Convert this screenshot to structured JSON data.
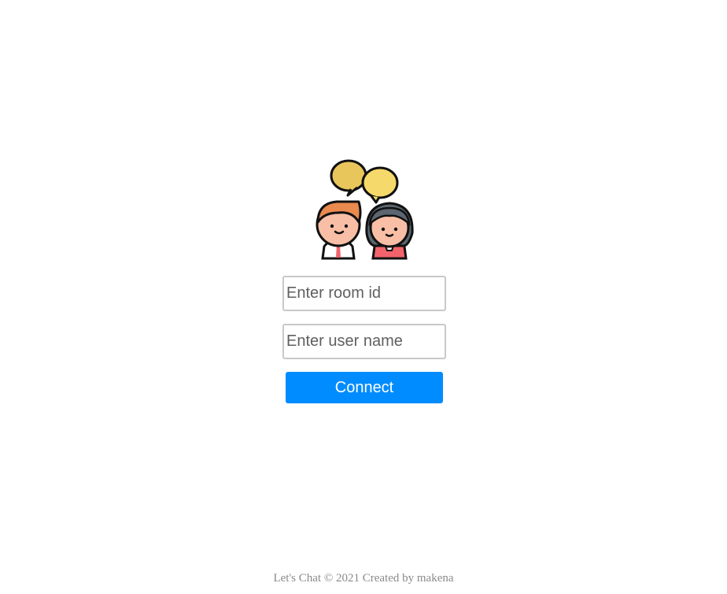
{
  "logo": {
    "icon": "chat-people-icon",
    "colors": {
      "bubble_left": "#e8c65c",
      "bubble_right": "#f6d96b",
      "skin": "#f8bfa6",
      "hair_boy": "#ea8a4f",
      "hair_girl": "#5c6670",
      "shirt_red": "#f2636b"
    }
  },
  "form": {
    "room_placeholder": "Enter room id",
    "room_value": "",
    "user_placeholder": "Enter user name",
    "user_value": "",
    "connect_label": "Connect",
    "accent": "#008cff"
  },
  "footer": {
    "text": "Let's Chat © 2021 Created by makena"
  }
}
